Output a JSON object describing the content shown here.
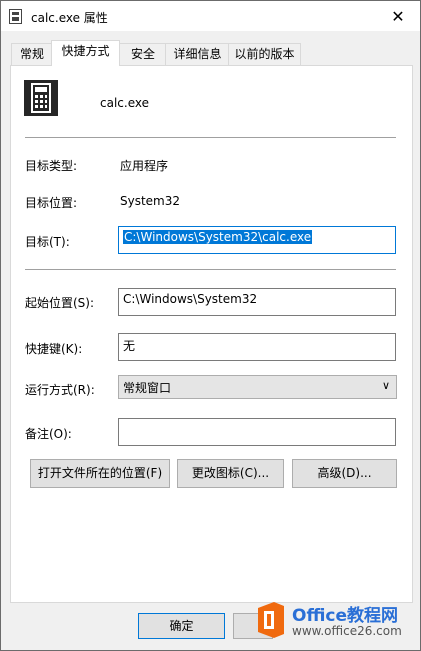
{
  "window": {
    "title": "calc.exe 属性"
  },
  "tabs": [
    {
      "label": "常规"
    },
    {
      "label": "快捷方式"
    },
    {
      "label": "安全"
    },
    {
      "label": "详细信息"
    },
    {
      "label": "以前的版本"
    }
  ],
  "active_tab": "快捷方式",
  "app": {
    "name": "calc.exe",
    "icon": "calculator-icon"
  },
  "info": {
    "target_type_label": "目标类型:",
    "target_type_value": "应用程序",
    "target_location_label": "目标位置:",
    "target_location_value": "System32"
  },
  "fields": {
    "target_label": "目标(T):",
    "target_value": "C:\\Windows\\System32\\calc.exe",
    "start_in_label": "起始位置(S):",
    "start_in_value": "C:\\Windows\\System32",
    "shortcut_key_label": "快捷键(K):",
    "shortcut_key_value": "无",
    "run_label": "运行方式(R):",
    "run_value": "常规窗口",
    "comment_label": "备注(O):",
    "comment_value": ""
  },
  "buttons": {
    "open_location": "打开文件所在的位置(F)",
    "change_icon": "更改图标(C)...",
    "advanced": "高级(D)...",
    "ok": "确定"
  },
  "watermark": {
    "title": "Office教程网",
    "url": "www.office26.com"
  },
  "colors": {
    "accent": "#0078d7",
    "watermark_orange": "#f06a0f"
  }
}
